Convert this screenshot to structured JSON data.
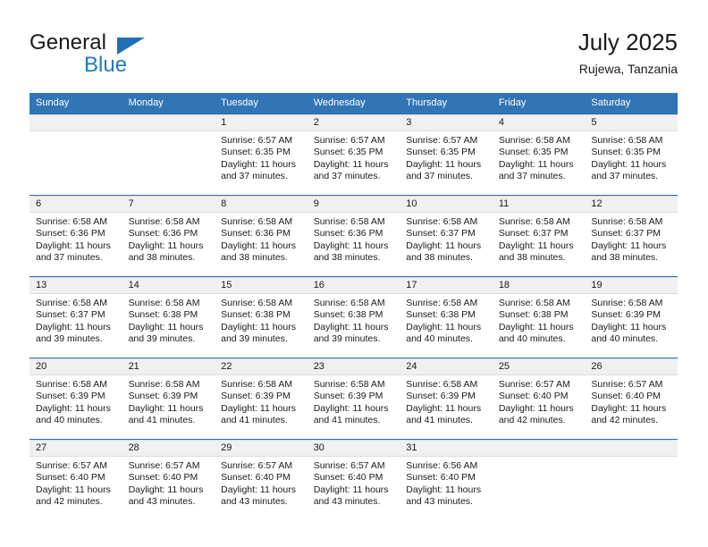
{
  "logo": {
    "word_top": "General",
    "word_bottom": "Blue",
    "triangle_icon": "triangle-icon",
    "color_dark": "#1a1a1a",
    "color_blue": "#1f7ac4"
  },
  "header": {
    "title": "July 2025",
    "subtitle": "Rujewa, Tanzania"
  },
  "colors": {
    "header_blue": "#3175b4",
    "row_divider_blue": "#2f6fae",
    "daynum_band": "#f0f0f0"
  },
  "weekday_headers": [
    "Sunday",
    "Monday",
    "Tuesday",
    "Wednesday",
    "Thursday",
    "Friday",
    "Saturday"
  ],
  "weeks": [
    [
      {
        "day": "",
        "lines": []
      },
      {
        "day": "",
        "lines": []
      },
      {
        "day": "1",
        "lines": [
          "Sunrise: 6:57 AM",
          "Sunset: 6:35 PM",
          "Daylight: 11 hours",
          "and 37 minutes."
        ]
      },
      {
        "day": "2",
        "lines": [
          "Sunrise: 6:57 AM",
          "Sunset: 6:35 PM",
          "Daylight: 11 hours",
          "and 37 minutes."
        ]
      },
      {
        "day": "3",
        "lines": [
          "Sunrise: 6:57 AM",
          "Sunset: 6:35 PM",
          "Daylight: 11 hours",
          "and 37 minutes."
        ]
      },
      {
        "day": "4",
        "lines": [
          "Sunrise: 6:58 AM",
          "Sunset: 6:35 PM",
          "Daylight: 11 hours",
          "and 37 minutes."
        ]
      },
      {
        "day": "5",
        "lines": [
          "Sunrise: 6:58 AM",
          "Sunset: 6:35 PM",
          "Daylight: 11 hours",
          "and 37 minutes."
        ]
      }
    ],
    [
      {
        "day": "6",
        "lines": [
          "Sunrise: 6:58 AM",
          "Sunset: 6:36 PM",
          "Daylight: 11 hours",
          "and 37 minutes."
        ]
      },
      {
        "day": "7",
        "lines": [
          "Sunrise: 6:58 AM",
          "Sunset: 6:36 PM",
          "Daylight: 11 hours",
          "and 38 minutes."
        ]
      },
      {
        "day": "8",
        "lines": [
          "Sunrise: 6:58 AM",
          "Sunset: 6:36 PM",
          "Daylight: 11 hours",
          "and 38 minutes."
        ]
      },
      {
        "day": "9",
        "lines": [
          "Sunrise: 6:58 AM",
          "Sunset: 6:36 PM",
          "Daylight: 11 hours",
          "and 38 minutes."
        ]
      },
      {
        "day": "10",
        "lines": [
          "Sunrise: 6:58 AM",
          "Sunset: 6:37 PM",
          "Daylight: 11 hours",
          "and 38 minutes."
        ]
      },
      {
        "day": "11",
        "lines": [
          "Sunrise: 6:58 AM",
          "Sunset: 6:37 PM",
          "Daylight: 11 hours",
          "and 38 minutes."
        ]
      },
      {
        "day": "12",
        "lines": [
          "Sunrise: 6:58 AM",
          "Sunset: 6:37 PM",
          "Daylight: 11 hours",
          "and 38 minutes."
        ]
      }
    ],
    [
      {
        "day": "13",
        "lines": [
          "Sunrise: 6:58 AM",
          "Sunset: 6:37 PM",
          "Daylight: 11 hours",
          "and 39 minutes."
        ]
      },
      {
        "day": "14",
        "lines": [
          "Sunrise: 6:58 AM",
          "Sunset: 6:38 PM",
          "Daylight: 11 hours",
          "and 39 minutes."
        ]
      },
      {
        "day": "15",
        "lines": [
          "Sunrise: 6:58 AM",
          "Sunset: 6:38 PM",
          "Daylight: 11 hours",
          "and 39 minutes."
        ]
      },
      {
        "day": "16",
        "lines": [
          "Sunrise: 6:58 AM",
          "Sunset: 6:38 PM",
          "Daylight: 11 hours",
          "and 39 minutes."
        ]
      },
      {
        "day": "17",
        "lines": [
          "Sunrise: 6:58 AM",
          "Sunset: 6:38 PM",
          "Daylight: 11 hours",
          "and 40 minutes."
        ]
      },
      {
        "day": "18",
        "lines": [
          "Sunrise: 6:58 AM",
          "Sunset: 6:38 PM",
          "Daylight: 11 hours",
          "and 40 minutes."
        ]
      },
      {
        "day": "19",
        "lines": [
          "Sunrise: 6:58 AM",
          "Sunset: 6:39 PM",
          "Daylight: 11 hours",
          "and 40 minutes."
        ]
      }
    ],
    [
      {
        "day": "20",
        "lines": [
          "Sunrise: 6:58 AM",
          "Sunset: 6:39 PM",
          "Daylight: 11 hours",
          "and 40 minutes."
        ]
      },
      {
        "day": "21",
        "lines": [
          "Sunrise: 6:58 AM",
          "Sunset: 6:39 PM",
          "Daylight: 11 hours",
          "and 41 minutes."
        ]
      },
      {
        "day": "22",
        "lines": [
          "Sunrise: 6:58 AM",
          "Sunset: 6:39 PM",
          "Daylight: 11 hours",
          "and 41 minutes."
        ]
      },
      {
        "day": "23",
        "lines": [
          "Sunrise: 6:58 AM",
          "Sunset: 6:39 PM",
          "Daylight: 11 hours",
          "and 41 minutes."
        ]
      },
      {
        "day": "24",
        "lines": [
          "Sunrise: 6:58 AM",
          "Sunset: 6:39 PM",
          "Daylight: 11 hours",
          "and 41 minutes."
        ]
      },
      {
        "day": "25",
        "lines": [
          "Sunrise: 6:57 AM",
          "Sunset: 6:40 PM",
          "Daylight: 11 hours",
          "and 42 minutes."
        ]
      },
      {
        "day": "26",
        "lines": [
          "Sunrise: 6:57 AM",
          "Sunset: 6:40 PM",
          "Daylight: 11 hours",
          "and 42 minutes."
        ]
      }
    ],
    [
      {
        "day": "27",
        "lines": [
          "Sunrise: 6:57 AM",
          "Sunset: 6:40 PM",
          "Daylight: 11 hours",
          "and 42 minutes."
        ]
      },
      {
        "day": "28",
        "lines": [
          "Sunrise: 6:57 AM",
          "Sunset: 6:40 PM",
          "Daylight: 11 hours",
          "and 43 minutes."
        ]
      },
      {
        "day": "29",
        "lines": [
          "Sunrise: 6:57 AM",
          "Sunset: 6:40 PM",
          "Daylight: 11 hours",
          "and 43 minutes."
        ]
      },
      {
        "day": "30",
        "lines": [
          "Sunrise: 6:57 AM",
          "Sunset: 6:40 PM",
          "Daylight: 11 hours",
          "and 43 minutes."
        ]
      },
      {
        "day": "31",
        "lines": [
          "Sunrise: 6:56 AM",
          "Sunset: 6:40 PM",
          "Daylight: 11 hours",
          "and 43 minutes."
        ]
      },
      {
        "day": "",
        "lines": []
      },
      {
        "day": "",
        "lines": []
      }
    ]
  ]
}
